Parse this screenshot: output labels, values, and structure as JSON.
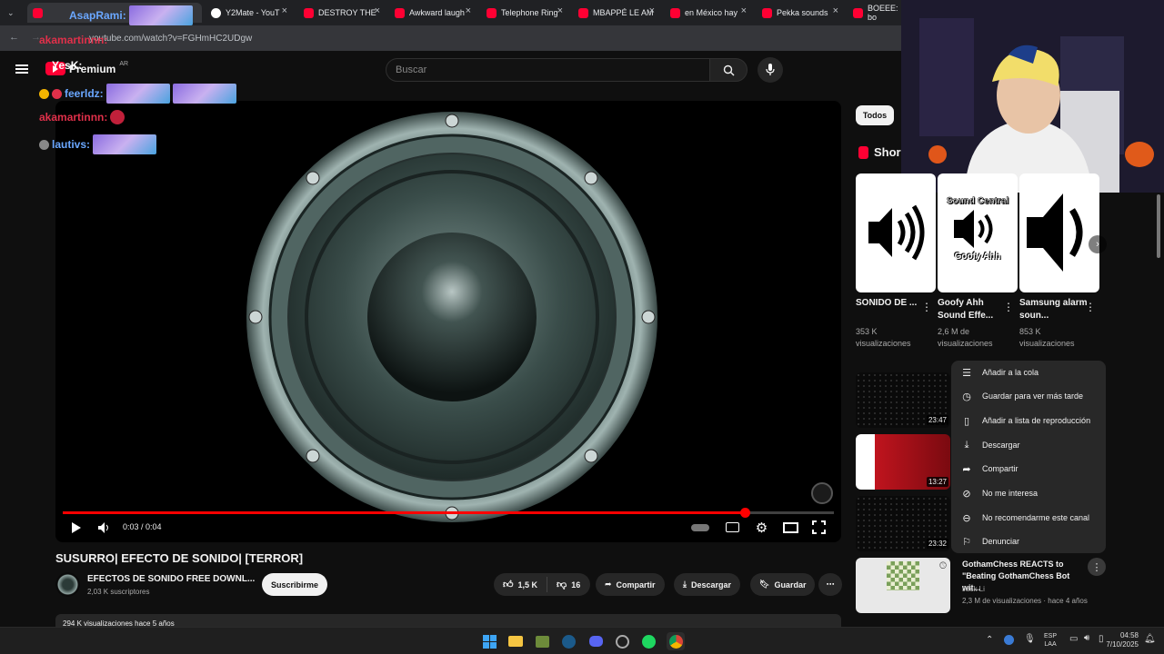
{
  "browser": {
    "tabs": [
      {
        "label": "AsapRami:",
        "color": "#ff0033"
      },
      {
        "label": "Y2Mate - YouT",
        "color": "#ffffff"
      },
      {
        "label": "DESTROY THE",
        "color": "#ff0033"
      },
      {
        "label": "Awkward laugh",
        "color": "#ff0033"
      },
      {
        "label": "Telephone Ring",
        "color": "#ff0033"
      },
      {
        "label": "MBAPPÉ LE AM",
        "color": "#ff0033"
      },
      {
        "label": "en México hay",
        "color": "#ff0033"
      },
      {
        "label": "Pekka sounds",
        "color": "#ff0033"
      },
      {
        "label": "BOEEE: bo",
        "color": "#ff0033"
      }
    ],
    "url": "youtube.com/watch?v=FGHmHC2UDgw"
  },
  "youtube": {
    "logo_text": "Premium",
    "logo_region": "AR",
    "search_placeholder": "Buscar",
    "video": {
      "time": "0:03 / 0:04",
      "progress_fraction": 0.885,
      "title": "SUSURRO| EFECTO DE SONIDO| [TERROR]",
      "channel": "EFECTOS DE SONIDO FREE DOWNL...",
      "subscribers": "2,03 K suscriptores",
      "subscribe_label": "Suscribirme",
      "likes": "1,5 K",
      "dislikes": "16",
      "share_label": "Compartir",
      "download_label": "Descargar",
      "save_label": "Guardar",
      "description_preview": "294 K visualizaciones  hace 5 años"
    },
    "sidebar": {
      "chip": "Todos",
      "shorts_label": "Shor",
      "shorts": [
        {
          "title": "SONIDO DE ...",
          "views": "353 K visualizaciones",
          "overlay": ""
        },
        {
          "title": "Goofy Ahh Sound Effe...",
          "views": "2,6 M de visualizaciones",
          "overlay_top": "Sound Central",
          "overlay_bottom": "Goofy Ahh"
        },
        {
          "title": "Samsung alarm soun...",
          "views": "853 K visualizaciones",
          "overlay": ""
        }
      ],
      "videos": [
        {
          "duration": "23:47"
        },
        {
          "duration": "13:27"
        },
        {
          "duration": "23:32"
        },
        {
          "title": "GothamChess REACTS to \"Beating GothamChess Bot wit...",
          "channel": "Jack Li",
          "meta": "2,3 M de visualizaciones · hace 4 años"
        }
      ]
    },
    "context_menu": [
      {
        "label": "Añadir a la cola",
        "icon": "queue-icon"
      },
      {
        "label": "Guardar para ver más tarde",
        "icon": "clock-icon"
      },
      {
        "label": "Añadir a lista de reproducción",
        "icon": "bookmark-icon"
      },
      {
        "label": "Descargar",
        "icon": "download-icon"
      },
      {
        "label": "Compartir",
        "icon": "share-icon"
      },
      {
        "label": "No me interesa",
        "icon": "block-icon"
      },
      {
        "label": "No recomendarme este canal",
        "icon": "minus-circle-icon"
      },
      {
        "label": "Denunciar",
        "icon": "flag-icon"
      }
    ]
  },
  "chat": {
    "lines": [
      {
        "user": "AsapRami:",
        "color": "#6aa7ff"
      },
      {
        "user": "akamartinnn:",
        "color": "#e0304a"
      },
      {
        "user": "YesK:",
        "color": "#ffffff"
      },
      {
        "user": "feerldz:",
        "color": "#6aa7ff"
      },
      {
        "user": "akamartinnn:",
        "color": "#e0304a"
      },
      {
        "user": "lautivs:",
        "color": "#6aa7ff"
      }
    ]
  },
  "taskbar": {
    "lang_top": "ESP",
    "lang_bottom": "LAA",
    "time": "04:58",
    "date": "7/10/2025"
  }
}
